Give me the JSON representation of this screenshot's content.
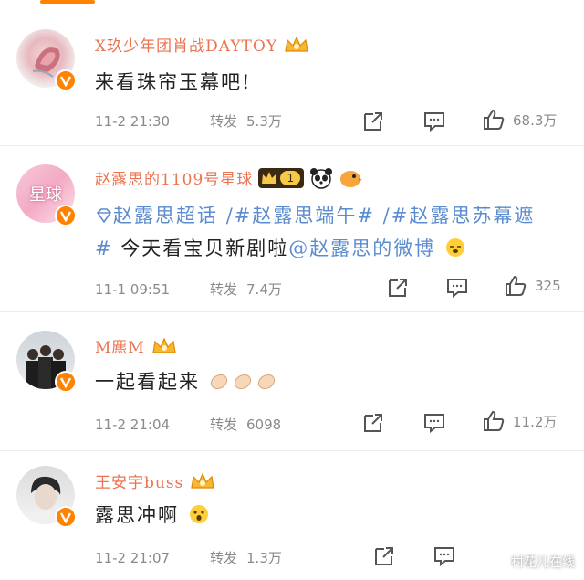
{
  "posts": [
    {
      "name": "X玖少年团肖战DAYTOY",
      "content": "来看珠帘玉幕吧!",
      "time": "11-2 21:30",
      "repost_label": "转发",
      "repost_count": "5.3万",
      "like_count": "68.3万",
      "avatar_icon": "rose-avatar",
      "vip": "crown-icon"
    },
    {
      "name": "赵露思的1109号星球",
      "content_parts": {
        "supertopic": "赵露思超话",
        "tag1": "/#赵露思端午#",
        "tag2": "/#赵露思苏幕遮#",
        "text": " 今天看宝贝新剧啦",
        "mention": "@赵露思的微博"
      },
      "avatar_text": "星球",
      "time": "11-1 09:51",
      "repost_label": "转发",
      "repost_count": "7.4万",
      "like_count": "325",
      "vip": "crown-level-icon",
      "vip_level": "1"
    },
    {
      "name": "M麃M",
      "content": "一起看起来",
      "time": "11-2 21:04",
      "repost_label": "转发",
      "repost_count": "6098",
      "like_count": "11.2万",
      "vip": "crown-icon"
    },
    {
      "name": "王安宇buss",
      "content": "露思冲啊",
      "time": "11-2 21:07",
      "repost_label": "转发",
      "repost_count": "1.3万",
      "like_count": "",
      "vip": "crown-icon"
    }
  ],
  "watermark": "村花儿在线",
  "colors": {
    "accent": "#ff8200",
    "name": "#eb7350",
    "link": "#5b8ccf",
    "meta": "#8a8a8a"
  }
}
